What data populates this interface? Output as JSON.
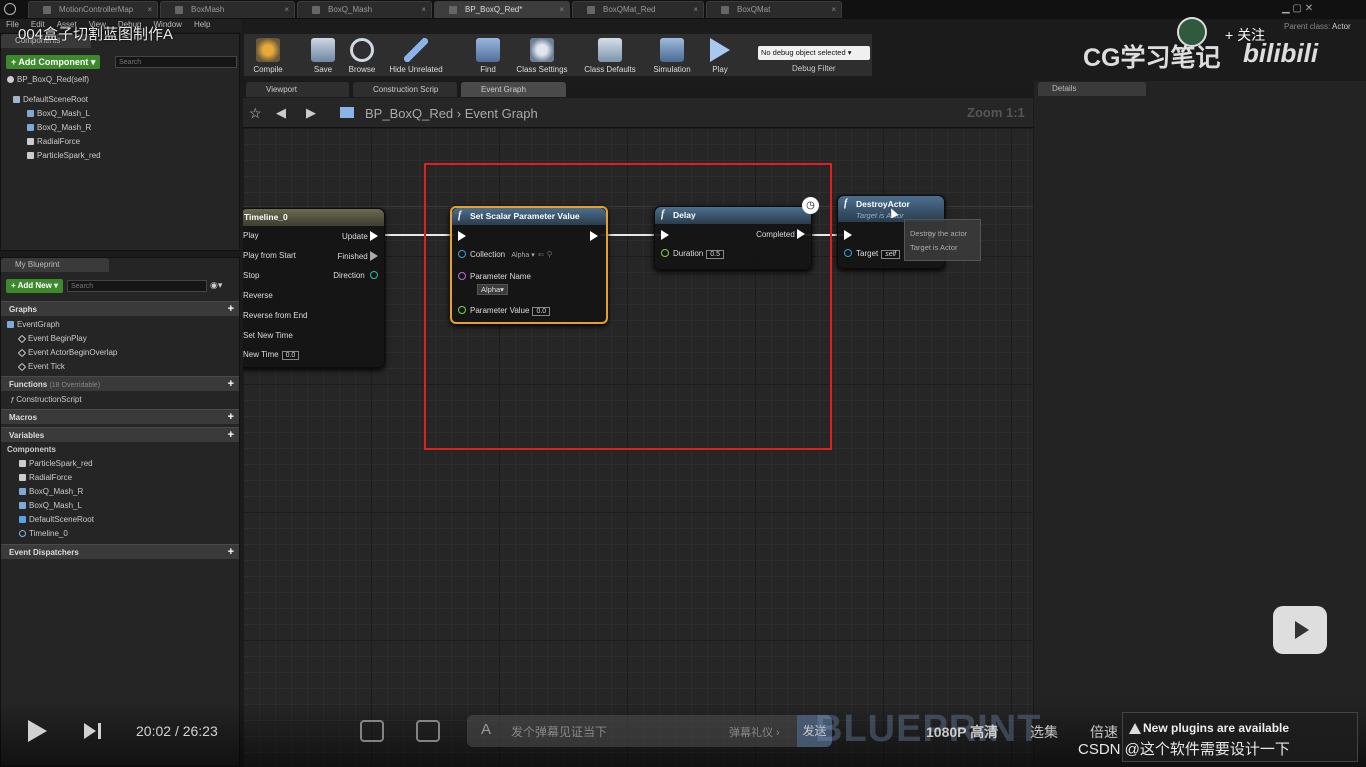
{
  "doc_tabs": [
    "MotionControllerMap",
    "BoxMash",
    "BoxQ_Mash",
    "BP_BoxQ_Red*",
    "BoxQMat_Red",
    "BoxQMat"
  ],
  "menu": [
    "File",
    "Edit",
    "Asset",
    "View",
    "Debug",
    "Window",
    "Help"
  ],
  "video_title": "004盒子切割蓝图制作A",
  "components": {
    "tab": "Components",
    "add_button": "+ Add Component ▾",
    "search_placeholder": "Search",
    "self_item": "BP_BoxQ_Red(self)",
    "tree": [
      "DefaultSceneRoot",
      "BoxQ_Mash_L",
      "BoxQ_Mash_R",
      "RadialForce",
      "ParticleSpark_red"
    ]
  },
  "my_blueprint": {
    "tab": "My Blueprint",
    "add_new": "+ Add New ▾",
    "search_placeholder": "Search",
    "graphs_header": "Graphs",
    "event_graph": "EventGraph",
    "events": [
      "Event BeginPlay",
      "Event ActorBeginOverlap",
      "Event Tick"
    ],
    "functions_header": "Functions",
    "functions_note": "(18 Overridable)",
    "functions": [
      "ConstructionScript"
    ],
    "macros_header": "Macros",
    "variables_header": "Variables",
    "components_header": "Components",
    "components": [
      "ParticleSpark_red",
      "RadialForce",
      "BoxQ_Mash_R",
      "BoxQ_Mash_L",
      "DefaultSceneRoot",
      "Timeline_0"
    ],
    "dispatchers_header": "Event Dispatchers"
  },
  "toolbar": {
    "buttons": [
      "Compile",
      "Save",
      "Browse",
      "Hide Unrelated",
      "Find",
      "Class Settings",
      "Class Defaults",
      "Simulation",
      "Play"
    ],
    "debug_select": "No debug object selected ▾",
    "debug_label": "Debug Filter"
  },
  "graph_tabs": [
    "Viewport",
    "Construction Scrip",
    "Event Graph"
  ],
  "breadcrumb": {
    "root": "BP_BoxQ_Red",
    "sep": "›",
    "current": "Event Graph",
    "zoom": "Zoom 1:1"
  },
  "nodes": {
    "timeline": {
      "title": "Timeline_0",
      "inputs": [
        "Play",
        "Play from Start",
        "Stop",
        "Reverse",
        "Reverse from End",
        "Set New Time",
        "New Time"
      ],
      "outputs": [
        "Update",
        "Finished",
        "Direction"
      ],
      "new_time_value": "0.0"
    },
    "set_scalar": {
      "title": "Set Scalar Parameter Value",
      "collection_label": "Collection",
      "collection_value": "Alpha ▾",
      "param_name_label": "Parameter Name",
      "param_name_value": "Alpha▾",
      "param_value_label": "Parameter Value",
      "param_value": "0.0"
    },
    "delay": {
      "title": "Delay",
      "completed": "Completed",
      "duration_label": "Duration",
      "duration_value": "0.5"
    },
    "destroy": {
      "title": "DestroyActor",
      "subtitle": "Target is Actor",
      "target_label": "Target",
      "target_value": "self"
    },
    "tooltip": {
      "line1": "Destroy the actor",
      "line2": "Target is Actor"
    }
  },
  "details": {
    "tab": "Details"
  },
  "overlay": {
    "watermark_cn": "CG学习笔记",
    "follow": "+ 关注",
    "bilibili": "bilibili",
    "time_current": "20:02",
    "time_sep": "/",
    "time_total": "26:23",
    "danmaku_placeholder": "发个弹幕见证当下",
    "danmaku_etiquette": "弹幕礼仪 ›",
    "send": "发送",
    "blueprint": "BLUEPRINT",
    "quality": "1080P 高清",
    "select_episode": "选集",
    "speed": "倍速",
    "notify": "New plugins are available",
    "csdn": "CSDN @这个软件需要设计一下",
    "parent_class_label": "Parent class:",
    "parent_class": "Actor"
  }
}
